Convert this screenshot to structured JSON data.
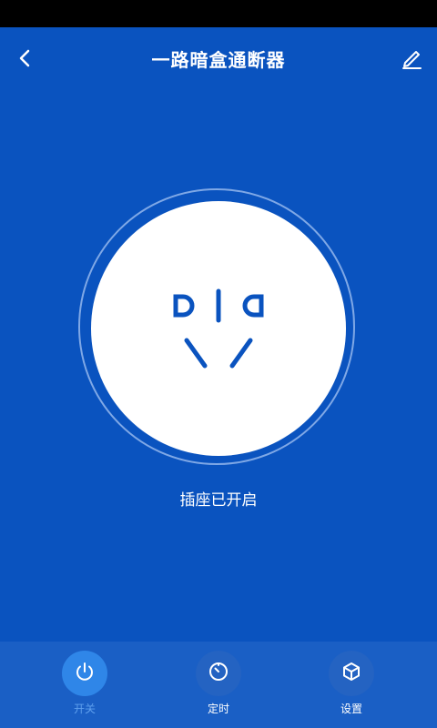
{
  "header": {
    "title": "一路暗盒通断器",
    "back_icon": "chevron-left-icon",
    "edit_icon": "pencil-icon"
  },
  "socket": {
    "icon": "power-socket-icon",
    "status_text": "插座已开启",
    "is_on": true
  },
  "bottom_nav": {
    "items": [
      {
        "label": "开关",
        "icon": "power-icon",
        "active": true
      },
      {
        "label": "定时",
        "icon": "timer-icon",
        "active": false
      },
      {
        "label": "设置",
        "icon": "cube-icon",
        "active": false
      }
    ]
  },
  "colors": {
    "background": "#0a53bf",
    "bottom_bar": "#1a5fc5",
    "accent": "#2f86e8",
    "socket_fill": "#ffffff",
    "socket_icon": "#0a53bf",
    "active_label": "#5fa0ee"
  }
}
